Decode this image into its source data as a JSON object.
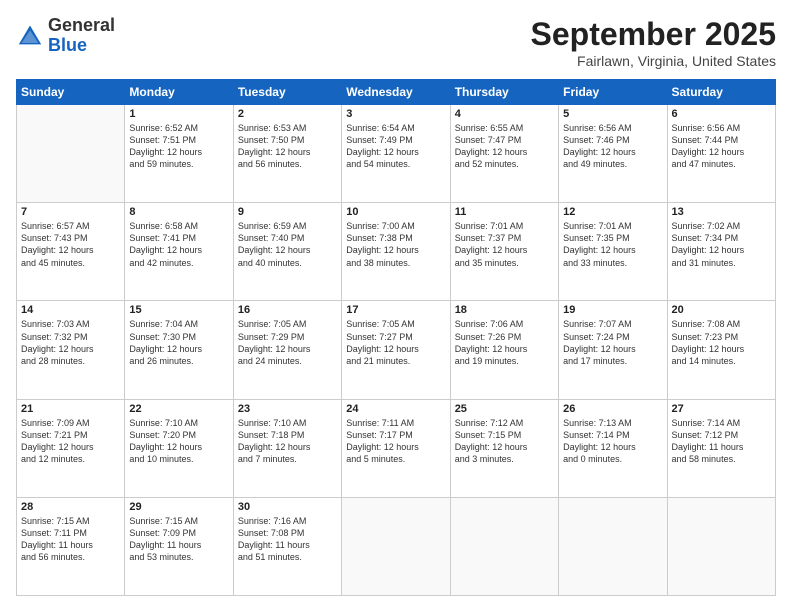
{
  "header": {
    "logo": {
      "general": "General",
      "blue": "Blue"
    },
    "title": "September 2025",
    "location": "Fairlawn, Virginia, United States"
  },
  "days_of_week": [
    "Sunday",
    "Monday",
    "Tuesday",
    "Wednesday",
    "Thursday",
    "Friday",
    "Saturday"
  ],
  "weeks": [
    [
      {
        "day": "",
        "content": ""
      },
      {
        "day": "1",
        "content": "Sunrise: 6:52 AM\nSunset: 7:51 PM\nDaylight: 12 hours\nand 59 minutes."
      },
      {
        "day": "2",
        "content": "Sunrise: 6:53 AM\nSunset: 7:50 PM\nDaylight: 12 hours\nand 56 minutes."
      },
      {
        "day": "3",
        "content": "Sunrise: 6:54 AM\nSunset: 7:49 PM\nDaylight: 12 hours\nand 54 minutes."
      },
      {
        "day": "4",
        "content": "Sunrise: 6:55 AM\nSunset: 7:47 PM\nDaylight: 12 hours\nand 52 minutes."
      },
      {
        "day": "5",
        "content": "Sunrise: 6:56 AM\nSunset: 7:46 PM\nDaylight: 12 hours\nand 49 minutes."
      },
      {
        "day": "6",
        "content": "Sunrise: 6:56 AM\nSunset: 7:44 PM\nDaylight: 12 hours\nand 47 minutes."
      }
    ],
    [
      {
        "day": "7",
        "content": "Sunrise: 6:57 AM\nSunset: 7:43 PM\nDaylight: 12 hours\nand 45 minutes."
      },
      {
        "day": "8",
        "content": "Sunrise: 6:58 AM\nSunset: 7:41 PM\nDaylight: 12 hours\nand 42 minutes."
      },
      {
        "day": "9",
        "content": "Sunrise: 6:59 AM\nSunset: 7:40 PM\nDaylight: 12 hours\nand 40 minutes."
      },
      {
        "day": "10",
        "content": "Sunrise: 7:00 AM\nSunset: 7:38 PM\nDaylight: 12 hours\nand 38 minutes."
      },
      {
        "day": "11",
        "content": "Sunrise: 7:01 AM\nSunset: 7:37 PM\nDaylight: 12 hours\nand 35 minutes."
      },
      {
        "day": "12",
        "content": "Sunrise: 7:01 AM\nSunset: 7:35 PM\nDaylight: 12 hours\nand 33 minutes."
      },
      {
        "day": "13",
        "content": "Sunrise: 7:02 AM\nSunset: 7:34 PM\nDaylight: 12 hours\nand 31 minutes."
      }
    ],
    [
      {
        "day": "14",
        "content": "Sunrise: 7:03 AM\nSunset: 7:32 PM\nDaylight: 12 hours\nand 28 minutes."
      },
      {
        "day": "15",
        "content": "Sunrise: 7:04 AM\nSunset: 7:30 PM\nDaylight: 12 hours\nand 26 minutes."
      },
      {
        "day": "16",
        "content": "Sunrise: 7:05 AM\nSunset: 7:29 PM\nDaylight: 12 hours\nand 24 minutes."
      },
      {
        "day": "17",
        "content": "Sunrise: 7:05 AM\nSunset: 7:27 PM\nDaylight: 12 hours\nand 21 minutes."
      },
      {
        "day": "18",
        "content": "Sunrise: 7:06 AM\nSunset: 7:26 PM\nDaylight: 12 hours\nand 19 minutes."
      },
      {
        "day": "19",
        "content": "Sunrise: 7:07 AM\nSunset: 7:24 PM\nDaylight: 12 hours\nand 17 minutes."
      },
      {
        "day": "20",
        "content": "Sunrise: 7:08 AM\nSunset: 7:23 PM\nDaylight: 12 hours\nand 14 minutes."
      }
    ],
    [
      {
        "day": "21",
        "content": "Sunrise: 7:09 AM\nSunset: 7:21 PM\nDaylight: 12 hours\nand 12 minutes."
      },
      {
        "day": "22",
        "content": "Sunrise: 7:10 AM\nSunset: 7:20 PM\nDaylight: 12 hours\nand 10 minutes."
      },
      {
        "day": "23",
        "content": "Sunrise: 7:10 AM\nSunset: 7:18 PM\nDaylight: 12 hours\nand 7 minutes."
      },
      {
        "day": "24",
        "content": "Sunrise: 7:11 AM\nSunset: 7:17 PM\nDaylight: 12 hours\nand 5 minutes."
      },
      {
        "day": "25",
        "content": "Sunrise: 7:12 AM\nSunset: 7:15 PM\nDaylight: 12 hours\nand 3 minutes."
      },
      {
        "day": "26",
        "content": "Sunrise: 7:13 AM\nSunset: 7:14 PM\nDaylight: 12 hours\nand 0 minutes."
      },
      {
        "day": "27",
        "content": "Sunrise: 7:14 AM\nSunset: 7:12 PM\nDaylight: 11 hours\nand 58 minutes."
      }
    ],
    [
      {
        "day": "28",
        "content": "Sunrise: 7:15 AM\nSunset: 7:11 PM\nDaylight: 11 hours\nand 56 minutes."
      },
      {
        "day": "29",
        "content": "Sunrise: 7:15 AM\nSunset: 7:09 PM\nDaylight: 11 hours\nand 53 minutes."
      },
      {
        "day": "30",
        "content": "Sunrise: 7:16 AM\nSunset: 7:08 PM\nDaylight: 11 hours\nand 51 minutes."
      },
      {
        "day": "",
        "content": ""
      },
      {
        "day": "",
        "content": ""
      },
      {
        "day": "",
        "content": ""
      },
      {
        "day": "",
        "content": ""
      }
    ]
  ]
}
